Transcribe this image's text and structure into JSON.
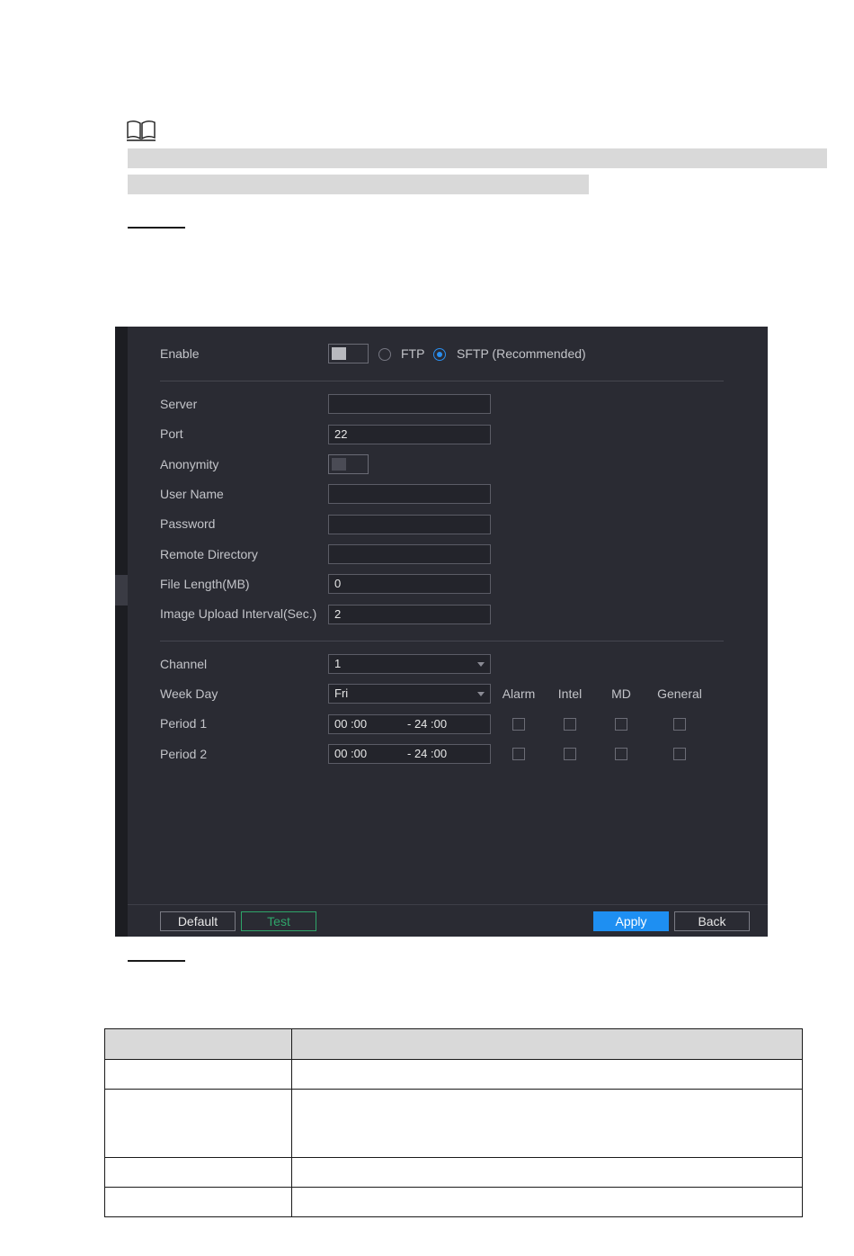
{
  "panel": {
    "enable_label": "Enable",
    "protocols": [
      {
        "label": "FTP",
        "selected": false
      },
      {
        "label": "SFTP (Recommended)",
        "selected": true
      }
    ],
    "fields": {
      "server": {
        "label": "Server",
        "value": ""
      },
      "port": {
        "label": "Port",
        "value": "22"
      },
      "anonymity": {
        "label": "Anonymity"
      },
      "user_name": {
        "label": "User Name",
        "value": ""
      },
      "password": {
        "label": "Password",
        "value": ""
      },
      "remote_directory": {
        "label": "Remote Directory",
        "value": ""
      },
      "file_length": {
        "label": "File Length(MB)",
        "value": "0"
      },
      "image_upload_interval": {
        "label": "Image Upload Interval(Sec.)",
        "value": "2"
      }
    },
    "schedule": {
      "channel": {
        "label": "Channel",
        "value": "1"
      },
      "week_day": {
        "label": "Week Day",
        "value": "Fri"
      },
      "columns": [
        "Alarm",
        "Intel",
        "MD",
        "General"
      ],
      "periods": [
        {
          "label": "Period 1",
          "start": "00 :00",
          "end": "- 24 :00"
        },
        {
          "label": "Period 2",
          "start": "00 :00",
          "end": "- 24 :00"
        }
      ]
    },
    "buttons": {
      "default": "Default",
      "test": "Test",
      "apply": "Apply",
      "back": "Back"
    }
  },
  "colors": {
    "panel_bg": "#2a2b33",
    "accent_blue": "#1e8ff2",
    "test_green": "#2fa56a"
  }
}
